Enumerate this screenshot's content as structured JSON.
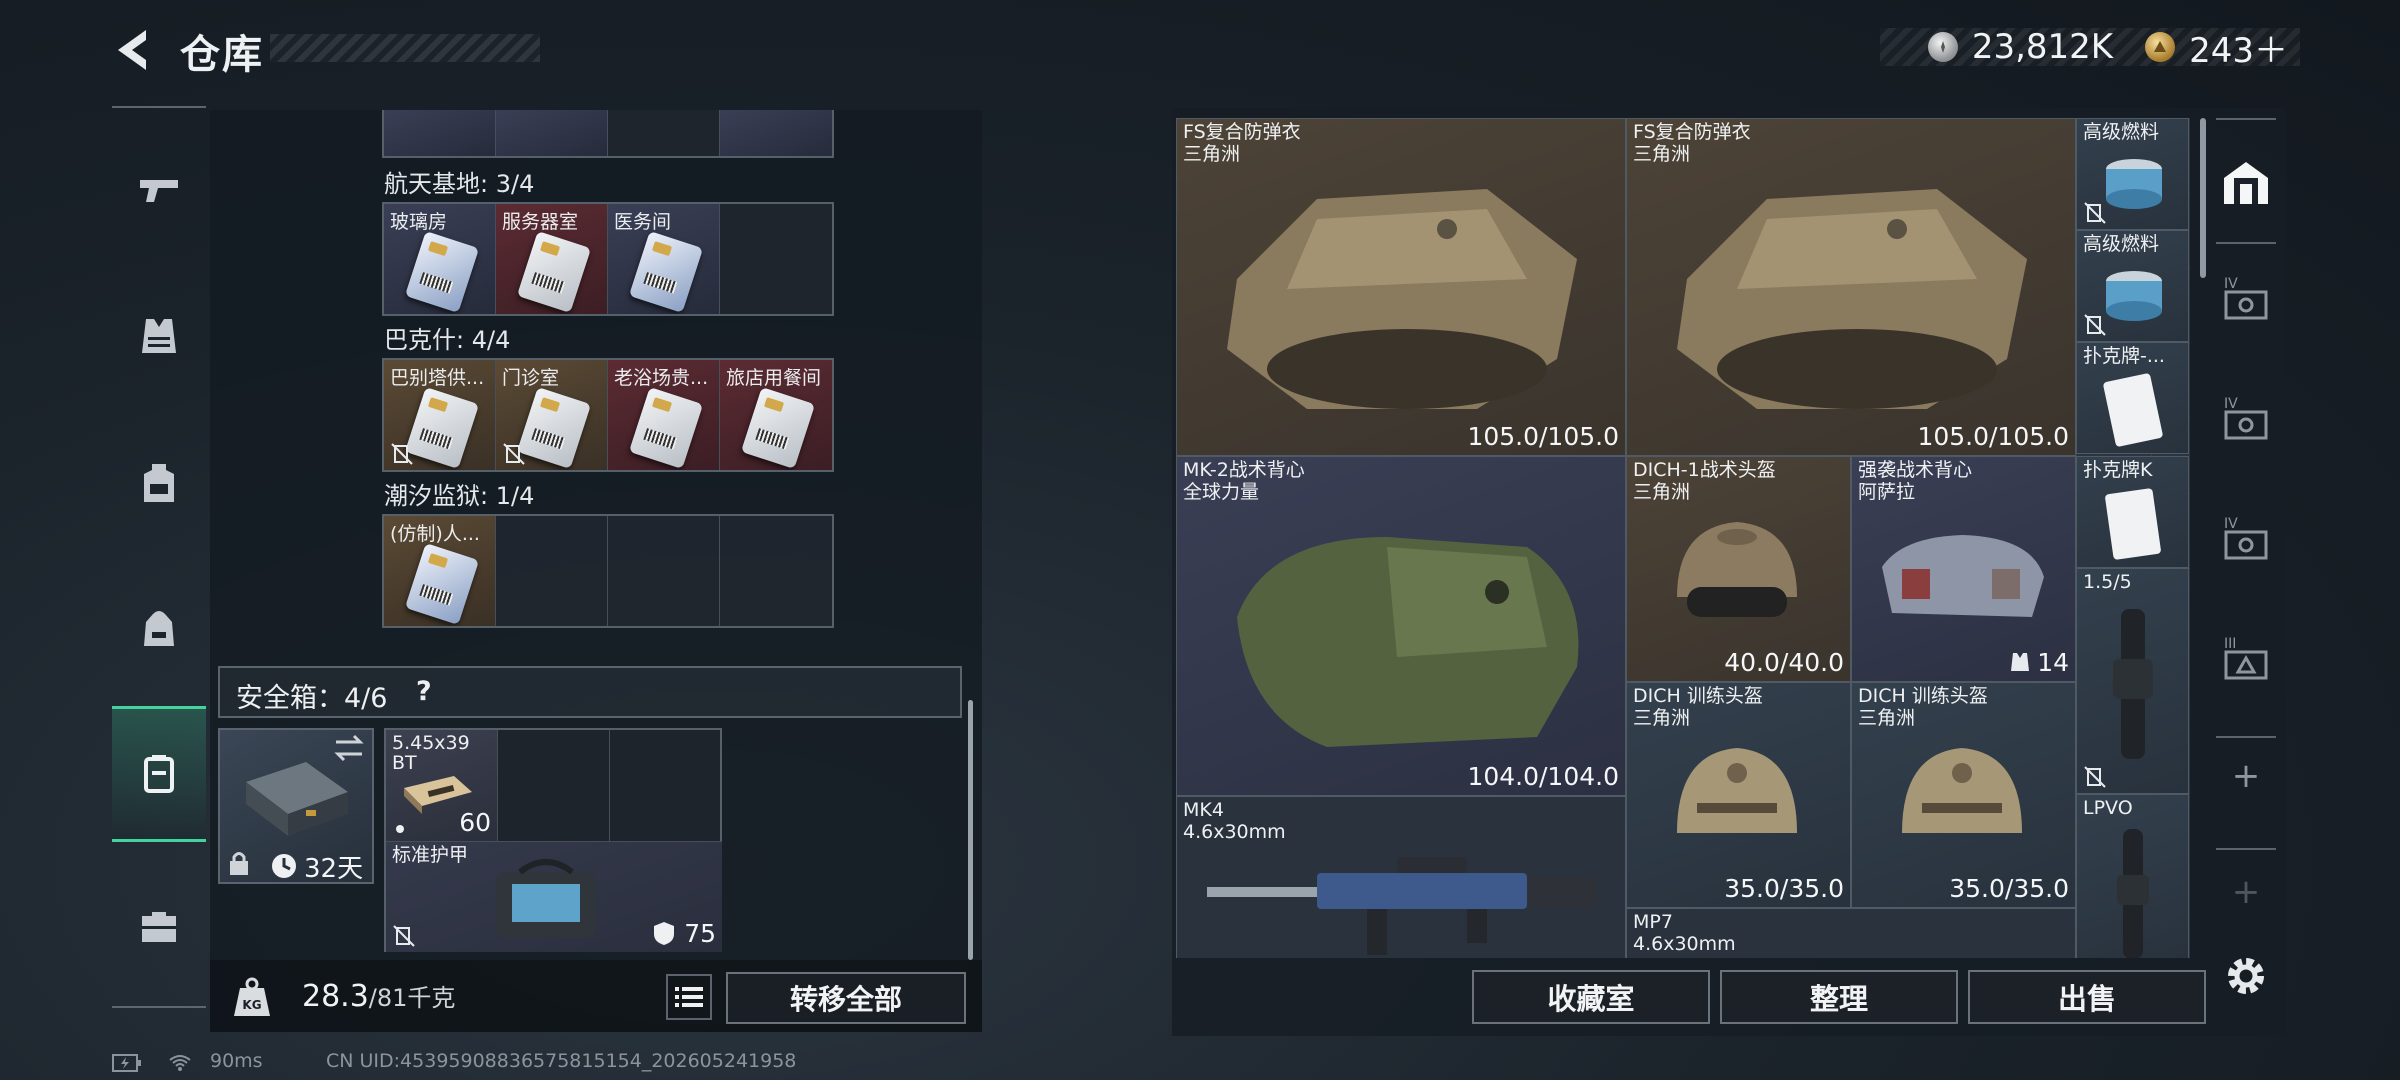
{
  "header": {
    "title": "仓库",
    "currencies": [
      {
        "icon": "silver-coin-icon",
        "value": "23,812K"
      },
      {
        "icon": "gold-coin-icon",
        "value": "243＋"
      }
    ]
  },
  "left_nav": {
    "items": [
      {
        "name": "weapon",
        "icon": "pistol-icon",
        "active": false
      },
      {
        "name": "vest",
        "icon": "vest-icon",
        "active": false
      },
      {
        "name": "backpack",
        "icon": "backpack-icon",
        "active": false
      },
      {
        "name": "bag",
        "icon": "bag-icon",
        "active": false
      },
      {
        "name": "safebox",
        "icon": "safebox-icon",
        "active": true
      },
      {
        "name": "toolbox",
        "icon": "toolbox-icon",
        "active": false
      }
    ]
  },
  "keycards": {
    "groups": [
      {
        "label": "航天基地: 3/4",
        "slots": [
          {
            "name": "玻璃房",
            "rarity": "blue"
          },
          {
            "name": "服务器室",
            "rarity": "red"
          },
          {
            "name": "医务间",
            "rarity": "blue"
          },
          {
            "name": "",
            "rarity": "empty"
          }
        ]
      },
      {
        "label": "巴克什: 4/4",
        "slots": [
          {
            "name": "巴别塔供...",
            "rarity": "gold",
            "nodrop": true
          },
          {
            "name": "门诊室",
            "rarity": "gold",
            "nodrop": true
          },
          {
            "name": "老浴场贵...",
            "rarity": "red"
          },
          {
            "name": "旅店用餐间",
            "rarity": "red"
          }
        ]
      },
      {
        "label": "潮汐监狱: 1/4",
        "slots": [
          {
            "name": "(仿制)人...",
            "rarity": "gold"
          },
          {
            "name": "",
            "rarity": "empty"
          },
          {
            "name": "",
            "rarity": "empty"
          },
          {
            "name": "",
            "rarity": "empty"
          }
        ]
      }
    ]
  },
  "safebox": {
    "label": "安全箱：4/6",
    "help": "?",
    "timer": "32天",
    "items": [
      {
        "name": "5.45x39",
        "sub": "BT",
        "count": "60"
      },
      {
        "name": "标准护甲",
        "value": "75"
      }
    ]
  },
  "weight": {
    "current": "28.3",
    "max": "/81千克"
  },
  "buttons": {
    "transfer_all": "转移全部",
    "collection": "收藏室",
    "sort": "整理",
    "sell": "出售"
  },
  "stash": {
    "items": [
      {
        "name": "FS复合防弹衣",
        "sub": "三角洲",
        "value": "105.0/105.0",
        "kind": "armor"
      },
      {
        "name": "FS复合防弹衣",
        "sub": "三角洲",
        "value": "105.0/105.0",
        "kind": "armor"
      },
      {
        "name": "高级燃料",
        "kind": "fuel"
      },
      {
        "name": "高级燃料",
        "kind": "fuel"
      },
      {
        "name": "扑克牌-...",
        "kind": "card"
      },
      {
        "name": "MK-2战术背心",
        "sub": "全球力量",
        "value": "104.0/104.0",
        "kind": "vest"
      },
      {
        "name": "DICH-1战术头盔",
        "sub": "三角洲",
        "value": "40.0/40.0",
        "kind": "helmet"
      },
      {
        "name": "强袭战术背心",
        "sub": "阿萨拉",
        "value": "14",
        "kind": "rig"
      },
      {
        "name": "扑克牌K",
        "kind": "card"
      },
      {
        "name": "1.5/5",
        "kind": "scope"
      },
      {
        "name": "DICH 训练头盔",
        "sub": "三角洲",
        "value": "35.0/35.0",
        "kind": "helmet"
      },
      {
        "name": "DICH 训练头盔",
        "sub": "三角洲",
        "value": "35.0/35.0",
        "kind": "helmet"
      },
      {
        "name": "MK4",
        "sub": "4.6x30mm",
        "kind": "rifle"
      },
      {
        "name": "LPVO",
        "kind": "scope"
      },
      {
        "name": "MP7",
        "sub": "4.6x30mm",
        "kind": "smg"
      }
    ]
  },
  "right_tabs": [
    {
      "icon": "storage-home-icon",
      "active": true
    },
    {
      "icon": "stash-tier-iv-icon",
      "label": "IV"
    },
    {
      "icon": "stash-tier-iv-icon",
      "label": "IV"
    },
    {
      "icon": "stash-tier-iv-icon",
      "label": "IV"
    },
    {
      "icon": "stash-tier-iii-icon",
      "label": "III"
    },
    {
      "icon": "plus-icon",
      "label": "+"
    },
    {
      "icon": "plus-icon",
      "label": "+"
    }
  ],
  "status_bar": {
    "ping": "90ms",
    "uid": "CN UID:45395908836575815154_202605241958"
  }
}
